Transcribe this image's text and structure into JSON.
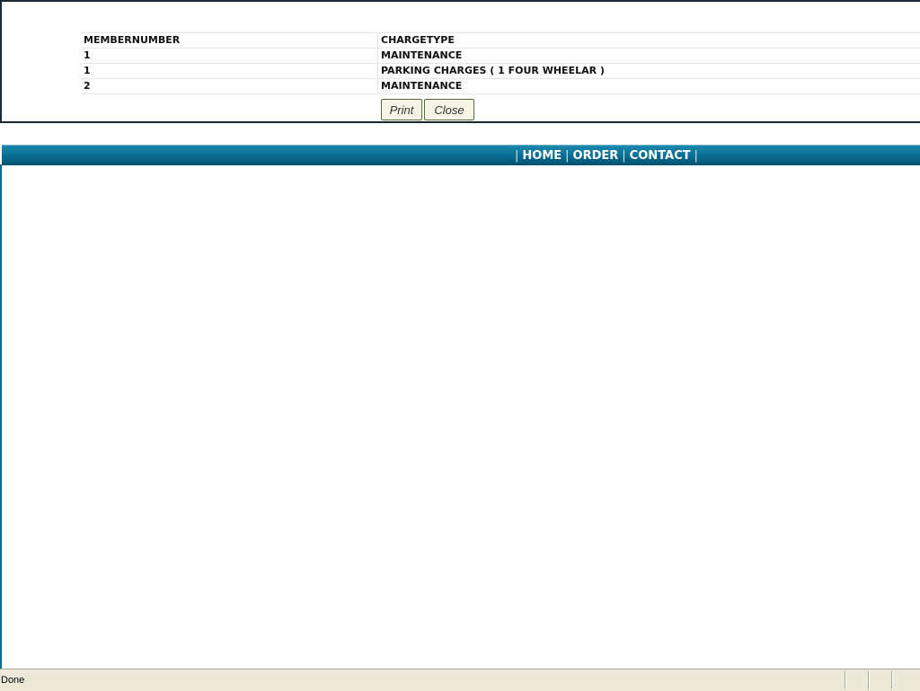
{
  "report": {
    "columns": [
      "MEMBERNUMBER",
      "CHARGETYPE"
    ],
    "rows": [
      [
        "1",
        "MAINTENANCE"
      ],
      [
        "1",
        "PARKING CHARGES ( 1 FOUR WHEELAR )"
      ],
      [
        "2",
        "MAINTENANCE"
      ]
    ],
    "buttons": {
      "print": "Print",
      "close": "Close"
    }
  },
  "nav": {
    "separator": "|",
    "links": [
      "HOME",
      "ORDER",
      "CONTACT"
    ]
  },
  "statusbar": {
    "text": "Done"
  },
  "colors": {
    "nav_bar": "#0a6f95",
    "frame_border": "#1b2a33",
    "button_border": "#556b2f",
    "status_bg": "#ece9d8"
  }
}
